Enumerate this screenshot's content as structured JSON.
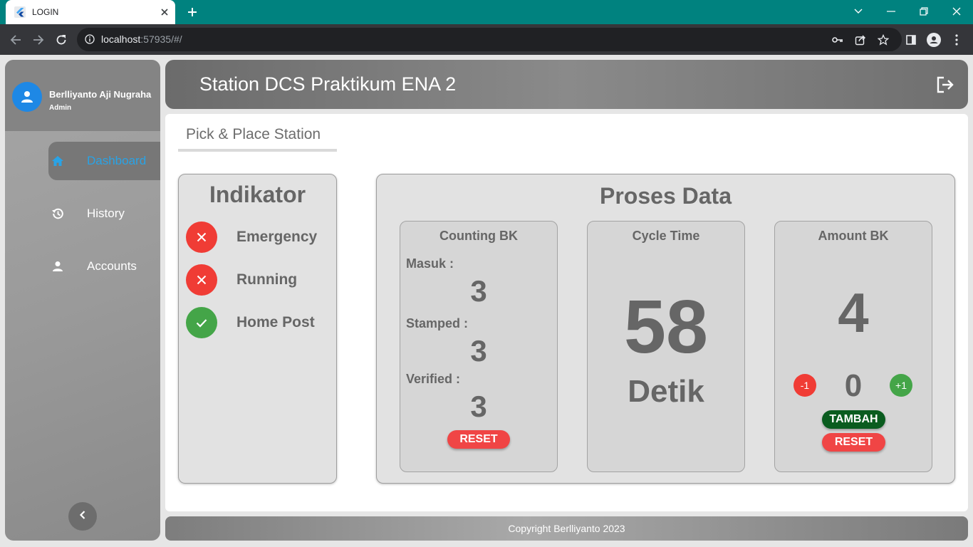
{
  "browser": {
    "tab_title": "LOGIN",
    "url_host": "localhost",
    "url_rest": ":57935/#/"
  },
  "user": {
    "name": "Berlliyanto Aji Nugraha",
    "role": "Admin"
  },
  "sidebar": {
    "items": [
      {
        "label": "Dashboard",
        "icon": "home-icon",
        "active": true
      },
      {
        "label": "History",
        "icon": "history-icon",
        "active": false
      },
      {
        "label": "Accounts",
        "icon": "person-icon",
        "active": false
      }
    ]
  },
  "header": {
    "title": "Station DCS Praktikum ENA 2"
  },
  "content": {
    "tab_label": "Pick & Place Station",
    "indikator": {
      "title": "Indikator",
      "items": [
        {
          "label": "Emergency",
          "status": "off",
          "color": "#f03c35"
        },
        {
          "label": "Running",
          "status": "off",
          "color": "#f03c35"
        },
        {
          "label": "Home Post",
          "status": "on",
          "color": "#44a548"
        }
      ]
    },
    "proses": {
      "title": "Proses Data",
      "counting": {
        "title": "Counting BK",
        "masuk_label": "Masuk :",
        "masuk_value": "3",
        "stamped_label": "Stamped :",
        "stamped_value": "3",
        "verified_label": "Verified :",
        "verified_value": "3",
        "reset_label": "RESET"
      },
      "cycle": {
        "title": "Cycle Time",
        "value": "58",
        "unit": "Detik"
      },
      "amount": {
        "title": "Amount BK",
        "value": "4",
        "minus_label": "-1",
        "step_value": "0",
        "plus_label": "+1",
        "tambah_label": "TAMBAH",
        "reset_label": "RESET"
      }
    }
  },
  "footer": {
    "text": "Copyright Berlliyanto 2023"
  }
}
